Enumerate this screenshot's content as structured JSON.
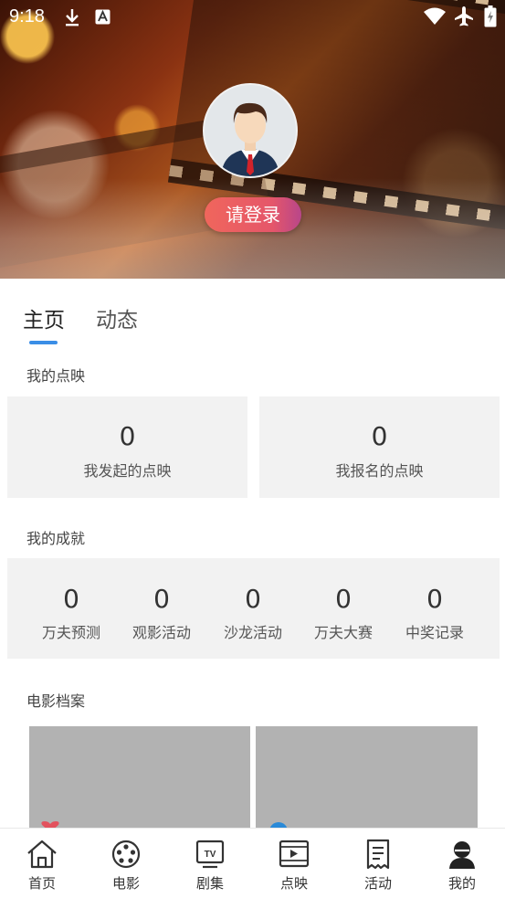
{
  "status_bar": {
    "time": "9:18",
    "icons": [
      "download-icon",
      "app-notification-icon",
      "wifi-icon",
      "airplane-mode-icon",
      "battery-charging-icon"
    ]
  },
  "profile": {
    "login_label": "请登录"
  },
  "tabs": [
    {
      "label": "主页",
      "active": true
    },
    {
      "label": "动态",
      "active": false
    }
  ],
  "screenings": {
    "title": "我的点映",
    "cards": [
      {
        "count": "0",
        "label": "我发起的点映"
      },
      {
        "count": "0",
        "label": "我报名的点映"
      }
    ]
  },
  "achievements": {
    "title": "我的成就",
    "items": [
      {
        "count": "0",
        "label": "万夫预测"
      },
      {
        "count": "0",
        "label": "观影活动"
      },
      {
        "count": "0",
        "label": "沙龙活动"
      },
      {
        "count": "0",
        "label": "万夫大赛"
      },
      {
        "count": "0",
        "label": "中奖记录"
      }
    ]
  },
  "archive": {
    "title": "电影档案"
  },
  "bottom_nav": [
    {
      "label": "首页",
      "icon": "home-icon"
    },
    {
      "label": "电影",
      "icon": "film-reel-icon"
    },
    {
      "label": "剧集",
      "icon": "tv-icon"
    },
    {
      "label": "点映",
      "icon": "screening-icon"
    },
    {
      "label": "活动",
      "icon": "activity-list-icon"
    },
    {
      "label": "我的",
      "icon": "profile-icon",
      "active": true
    }
  ],
  "colors": {
    "accent_blue": "#3a8ee6",
    "login_gradient_start": "#f0665c",
    "login_gradient_end": "#b8468a",
    "card_bg": "#f2f2f2",
    "placeholder_gray": "#b2b2b2"
  }
}
